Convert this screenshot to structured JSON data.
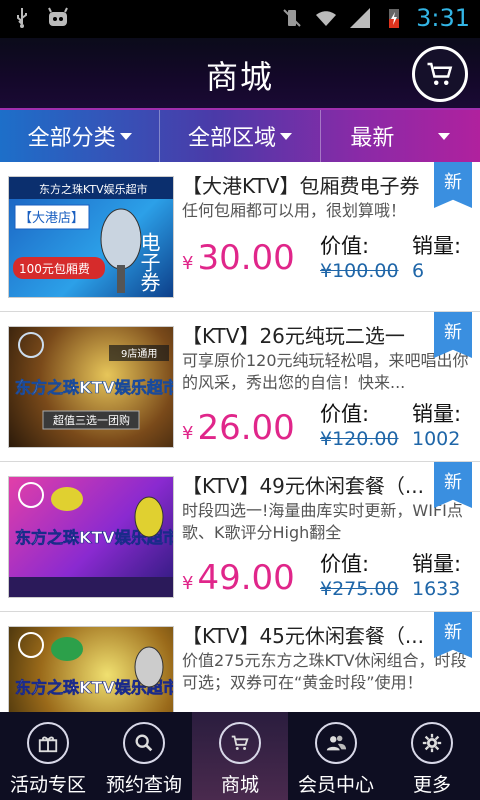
{
  "status_bar": {
    "time": "3:31"
  },
  "header": {
    "title": "商城"
  },
  "filters": [
    {
      "label": "全部分类"
    },
    {
      "label": "全部区域"
    },
    {
      "label": "最新"
    }
  ],
  "list": {
    "value_label": "价值:",
    "sales_label": "销量:",
    "currency": "¥",
    "new_badge": "新",
    "items": [
      {
        "title": "【大港KTV】包厢费电子券",
        "desc": "任何包厢都可以用，很划算哦！",
        "price": "30.00",
        "original": "¥100.00",
        "sales": "6",
        "thumb_text": "东方之珠KTV娱乐超市",
        "thumb_sub": "【大港店】",
        "thumb_tag": "100元包厢费",
        "thumb_side": "电子券"
      },
      {
        "title": "【KTV】26元纯玩二选一",
        "desc": "可享原价120元纯玩轻松唱，来吧唱出你的风采，秀出您的自信！快来...",
        "price": "26.00",
        "original": "¥120.00",
        "sales": "1002",
        "thumb_text": "东方之珠KTV娱乐超市",
        "thumb_sub": "9店通用",
        "thumb_tag": "超值三选一团购",
        "thumb_side": ""
      },
      {
        "title": "【KTV】49元休闲套餐（...",
        "desc": "时段四选一!海量曲库实时更新，WIFI点歌、K歌评分High翻全",
        "price": "49.00",
        "original": "¥275.00",
        "sales": "1633",
        "thumb_text": "东方之珠KTV娱乐超市",
        "thumb_sub": "",
        "thumb_tag": "",
        "thumb_side": ""
      },
      {
        "title": "【KTV】45元休闲套餐（...",
        "desc": "价值275元东方之珠KTV休闲组合，时段可选；双券可在“黄金时段”使用！",
        "price": "",
        "original": "",
        "sales": "",
        "thumb_text": "东方之珠KTV娱乐超市",
        "thumb_sub": "",
        "thumb_tag": "",
        "thumb_side": ""
      }
    ]
  },
  "bottom_nav": [
    {
      "label": "活动专区",
      "icon": "gift-icon"
    },
    {
      "label": "预约查询",
      "icon": "search-icon"
    },
    {
      "label": "商城",
      "icon": "cart-icon"
    },
    {
      "label": "会员中心",
      "icon": "members-icon"
    },
    {
      "label": "更多",
      "icon": "gear-icon"
    }
  ],
  "colors": {
    "accent_price": "#e0268a",
    "accent_blue": "#1f66a8",
    "badge": "#3a8fe0",
    "clock": "#33b5e5"
  }
}
